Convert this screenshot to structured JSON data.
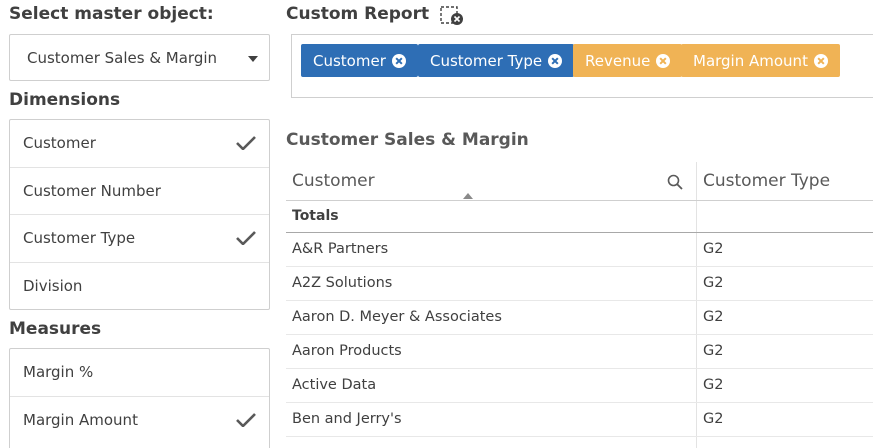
{
  "left": {
    "select_heading": "Select master object:",
    "selected_object": "Customer Sales & Margin",
    "dimensions_heading": "Dimensions",
    "dimensions": [
      {
        "label": "Customer",
        "checked": true
      },
      {
        "label": "Customer Number",
        "checked": false
      },
      {
        "label": "Customer Type",
        "checked": true
      },
      {
        "label": "Division",
        "checked": false
      }
    ],
    "measures_heading": "Measures",
    "measures": [
      {
        "label": "Margin %",
        "checked": false
      },
      {
        "label": "Margin Amount",
        "checked": true
      }
    ]
  },
  "report": {
    "title": "Custom Report",
    "chips": [
      {
        "label": "Customer",
        "kind": "dimension",
        "color": "#2e6eb5"
      },
      {
        "label": "Customer Type",
        "kind": "dimension",
        "color": "#2e6eb5"
      },
      {
        "label": "Revenue",
        "kind": "measure",
        "color": "#f0b355"
      },
      {
        "label": "Margin Amount",
        "kind": "measure",
        "color": "#f0b355"
      }
    ]
  },
  "table": {
    "title": "Customer Sales & Margin",
    "columns": [
      "Customer",
      "Customer Type"
    ],
    "totals_label": "Totals",
    "rows": [
      [
        "A&R Partners",
        "G2"
      ],
      [
        "A2Z Solutions",
        "G2"
      ],
      [
        "Aaron D. Meyer & Associates",
        "G2"
      ],
      [
        "Aaron Products",
        "G2"
      ],
      [
        "Active Data",
        "G2"
      ],
      [
        "Ben and Jerry's",
        "G2"
      ]
    ]
  },
  "icons": {
    "check": "checkmark-icon",
    "remove": "close-circle-icon",
    "search": "search-icon",
    "clear_selection": "clear-selection-icon",
    "sort": "sort-ascending-icon",
    "dropdown": "chevron-down-icon"
  }
}
